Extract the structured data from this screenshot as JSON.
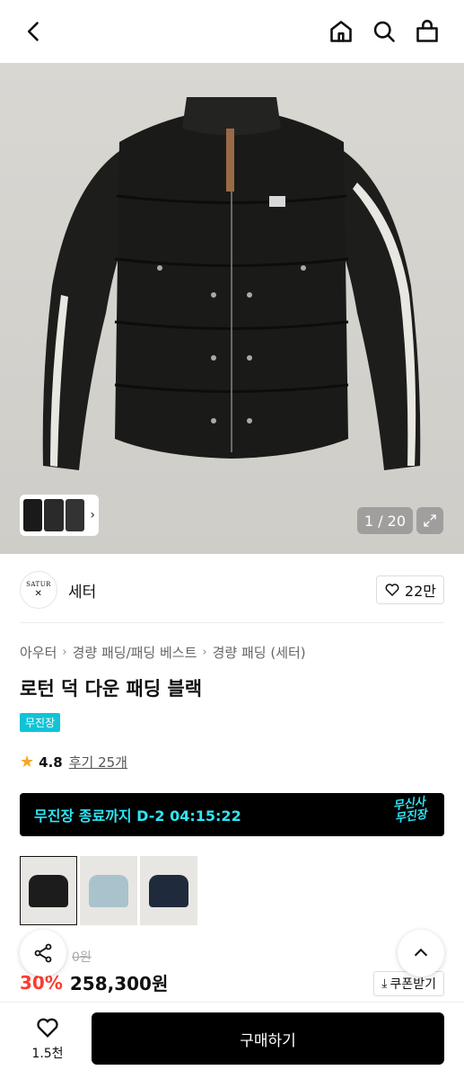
{
  "header": {
    "back_icon": "chevron-left-icon",
    "home_icon": "home-icon",
    "search_icon": "search-icon",
    "cart_icon": "shopping-bag-icon"
  },
  "gallery": {
    "counter": "1 / 20",
    "expand_icon": "expand-icon"
  },
  "brand": {
    "logo_text": "SATUR",
    "name": "세터",
    "likes": "22만"
  },
  "breadcrumb": [
    "아우터",
    "경량 패딩/패딩 베스트",
    "경량 패딩 (세터)"
  ],
  "product": {
    "title": "로턴 덕 다운 패딩 블랙",
    "badge": "무진장",
    "rating": "4.8",
    "reviews": "후기 25개"
  },
  "banner": {
    "text": "무진장 종료까지 D-2 04:15:22",
    "logo_line1": "무신사",
    "logo_line2": "무진장"
  },
  "colors": {
    "accent": "#2ee5f5",
    "badge": "#11c3d6",
    "discount": "#ff3b30",
    "options": [
      "#1c1c1c",
      "#a9c3cc",
      "#1f2a3d"
    ]
  },
  "price": {
    "original": "0원",
    "discount": "30%",
    "sale": "258,300원",
    "coupon": "쿠폰받기"
  },
  "bottom": {
    "wish_count": "1.5천",
    "buy_label": "구매하기"
  }
}
